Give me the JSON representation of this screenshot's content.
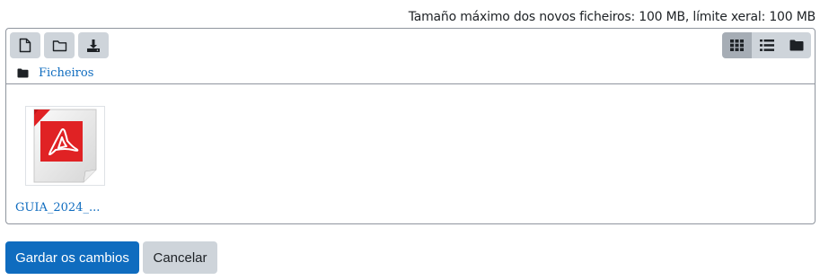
{
  "limits": {
    "text": "Tamaño máximo dos novos ficheiros: 100 MB, límite xeral: 100 MB"
  },
  "toolbar": {
    "buttons": [
      {
        "icon": "file-icon",
        "name": "add-file-button"
      },
      {
        "icon": "folder-icon",
        "name": "create-folder-button"
      },
      {
        "icon": "download-icon",
        "name": "download-button"
      }
    ],
    "views": [
      {
        "icon": "grid-icon",
        "name": "view-icons-button",
        "active": true
      },
      {
        "icon": "list-icon",
        "name": "view-list-button",
        "active": false
      },
      {
        "icon": "folder-icon",
        "name": "view-tree-button",
        "active": false
      }
    ]
  },
  "path": {
    "label": "Ficheiros"
  },
  "files": [
    {
      "name": "GUIA_2024_...",
      "icon": "pdf-icon"
    }
  ],
  "actions": {
    "save_label": "Gardar os cambios",
    "cancel_label": "Cancelar"
  },
  "colors": {
    "primary": "#0f6cbf",
    "button_grey": "#ced4da",
    "active_view": "#a6adb5",
    "pdf_red": "#e02224"
  }
}
